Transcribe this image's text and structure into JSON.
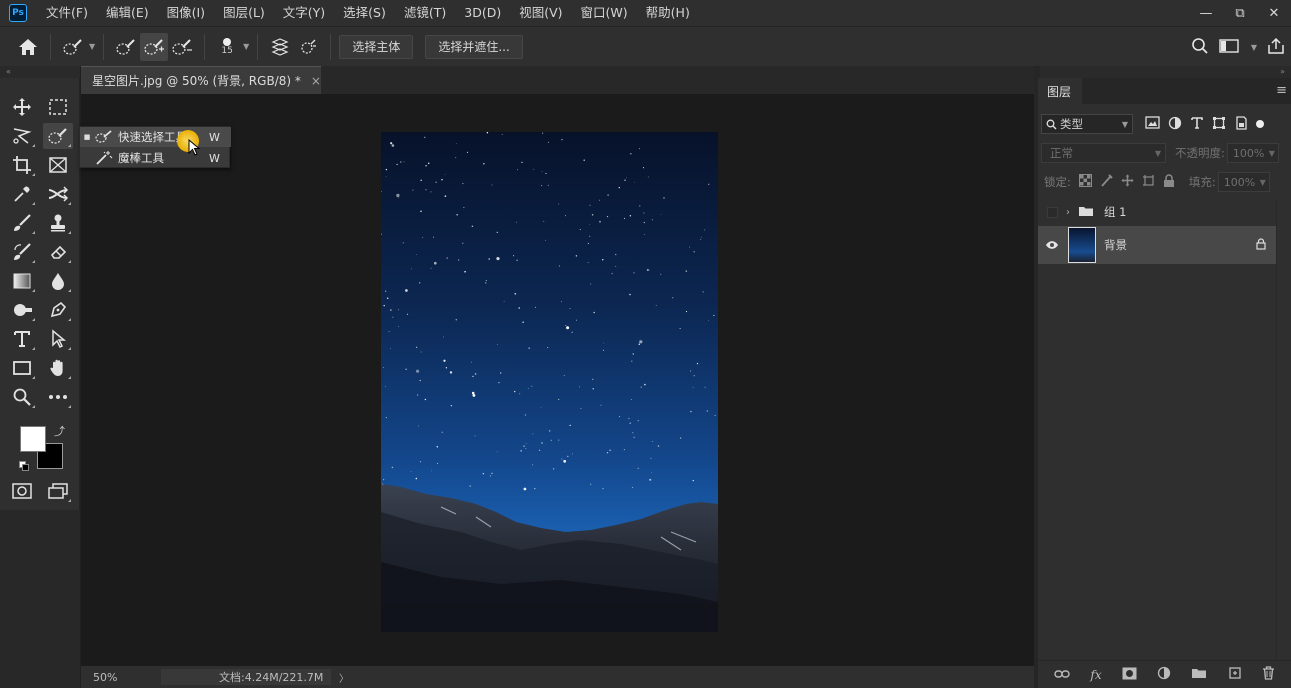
{
  "app": {
    "logo_text": "Ps",
    "menus": [
      "文件(F)",
      "编辑(E)",
      "图像(I)",
      "图层(L)",
      "文字(Y)",
      "选择(S)",
      "滤镜(T)",
      "3D(D)",
      "视图(V)",
      "窗口(W)",
      "帮助(H)"
    ]
  },
  "window_controls": {
    "minimize": "—",
    "restore": "⧉",
    "close": "✕"
  },
  "options_bar": {
    "brush_size": "15",
    "select_subject_label": "选择主体",
    "select_and_mask_label": "选择并遮住..."
  },
  "document": {
    "tab_title": "星空图片.jpg @ 50% (背景, RGB/8) *",
    "tab_close": "×"
  },
  "flyout": {
    "items": [
      {
        "label": "快速选择工具",
        "shortcut": "W",
        "selected": true
      },
      {
        "label": "魔棒工具",
        "shortcut": "W",
        "selected": false
      }
    ]
  },
  "status_bar": {
    "zoom": "50%",
    "doc_info": "文档:4.24M/221.7M",
    "arrow": "〉"
  },
  "layers_panel": {
    "tab_label": "图层",
    "filter_kind": "类型",
    "blend_mode": "正常",
    "opacity_label": "不透明度:",
    "opacity_value": "100%",
    "lock_label": "锁定:",
    "fill_label": "填充:",
    "fill_value": "100%",
    "layers": [
      {
        "name": "组 1",
        "type": "group",
        "visible": false
      },
      {
        "name": "背景",
        "type": "image",
        "visible": true,
        "locked": true
      }
    ]
  },
  "colors": {
    "foreground": "#ffffff",
    "background": "#000000",
    "accent": "#31a8ff",
    "cursor_highlight": "#f2b400"
  },
  "icons": {
    "tools_left": [
      "move-icon",
      "lasso-icon",
      "crop-icon",
      "eyedropper-icon",
      "brush-icon",
      "history-brush-icon",
      "gradient-icon",
      "dodge-icon",
      "type-icon",
      "rectangle-icon",
      "zoom-icon",
      "quick-mask-icon"
    ],
    "tools_right": [
      "marquee-icon",
      "quick-selection-icon",
      "frame-icon",
      "patch-icon",
      "stamp-icon",
      "eraser-icon",
      "blur-icon",
      "pen-icon",
      "path-selection-icon",
      "hand-icon",
      "more-tools-icon",
      "screen-mode-icon"
    ]
  }
}
